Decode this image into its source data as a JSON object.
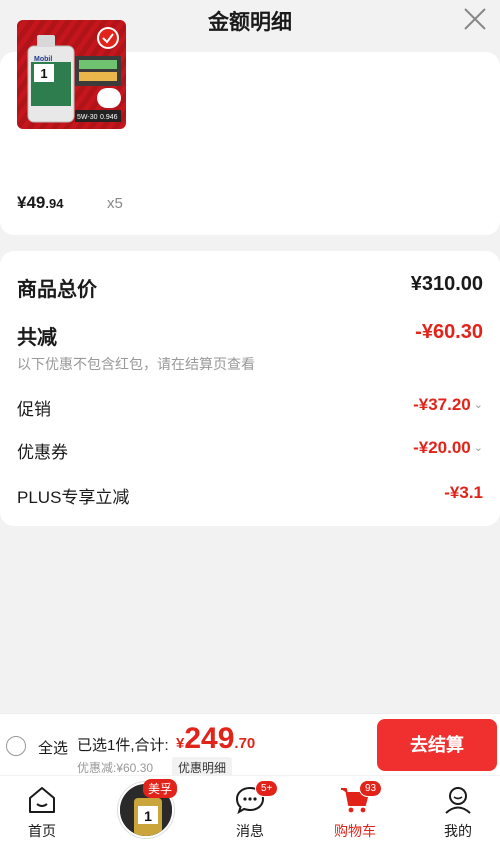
{
  "header": {
    "title": "金额明细",
    "close_icon": "close-icon"
  },
  "product": {
    "image_icon": "mobil-1-oil-bottle-image",
    "price_int": "¥49",
    "price_dec": ".94",
    "quantity": "x5",
    "checked": true,
    "thumb_text": {
      "brand": "Mobil",
      "model": "1",
      "spec": "5W-30",
      "volume": "0.946"
    }
  },
  "detail": {
    "total_label": "商品总价",
    "total_value": "¥310.00",
    "reduce_label": "共减",
    "reduce_value": "-¥60.30",
    "note": "以下优惠不包含红包，请在结算页查看",
    "promo_label": "促销",
    "promo_value": "-¥37.20",
    "coupon_label": "优惠券",
    "coupon_value": "-¥20.00",
    "plus_label": "PLUS专享立减",
    "plus_value": "-¥3.1"
  },
  "bottom_bar": {
    "select_all": "全选",
    "summary": "已选1件,合计:",
    "total_symbol": "¥",
    "total_int": "249",
    "total_dec": ".70",
    "discount_line": "优惠减:¥60.30",
    "detail_chip": "优惠明细",
    "checkout": "去结算"
  },
  "tabbar": {
    "home": "首页",
    "promo_badge": "美孚",
    "messages": "消息",
    "messages_badge": "5+",
    "cart": "购物车",
    "cart_badge": "93",
    "mine": "我的"
  },
  "colors": {
    "accent": "#e2231a",
    "checkout_bg": "#f0302f"
  }
}
